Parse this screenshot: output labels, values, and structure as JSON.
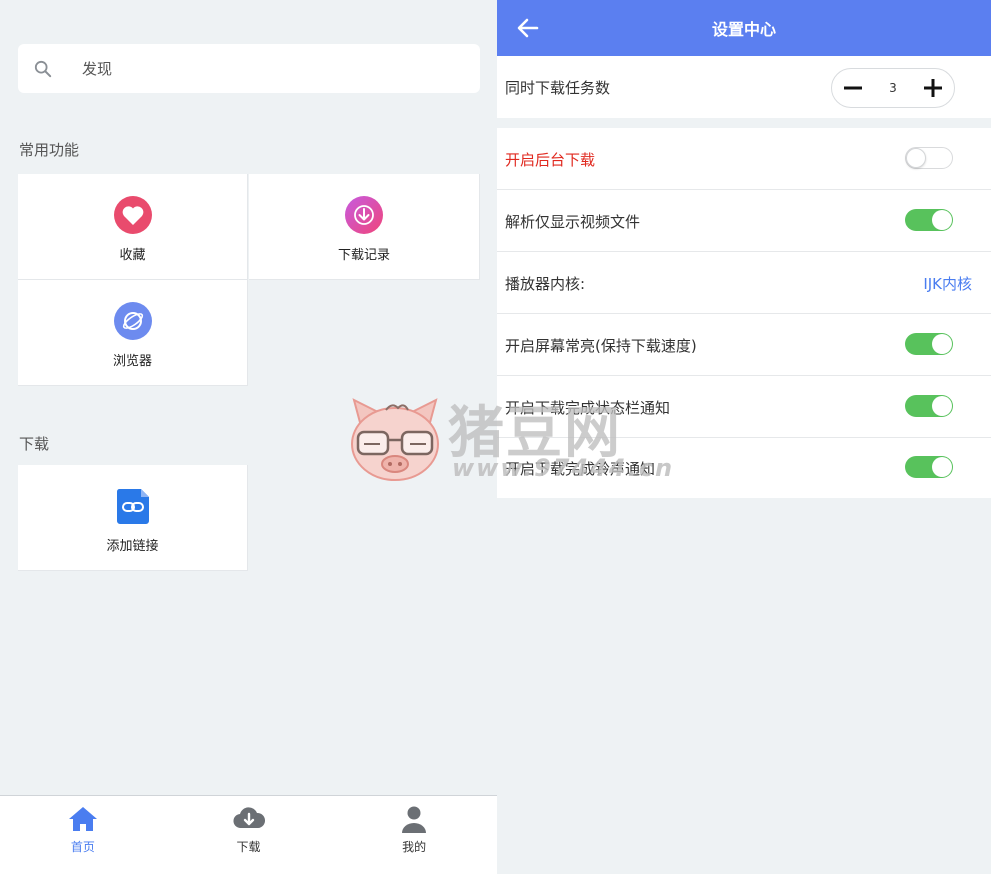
{
  "left": {
    "search": {
      "placeholder": "发现"
    },
    "sections": {
      "common": "常用功能",
      "download": "下载"
    },
    "common_items": [
      {
        "label": "收藏",
        "icon": "heart-icon",
        "color": "#e94b6d"
      },
      {
        "label": "下载记录",
        "icon": "download-arrow-icon",
        "color": "#e24a8a"
      },
      {
        "label": "浏览器",
        "icon": "planet-icon",
        "color": "#6d8bef"
      }
    ],
    "download_items": [
      {
        "label": "添加链接",
        "icon": "link-icon",
        "color": "#2a79e8"
      }
    ],
    "tabs": [
      {
        "label": "首页",
        "icon": "home-icon",
        "active": true
      },
      {
        "label": "下载",
        "icon": "cloud-download-icon",
        "active": false
      },
      {
        "label": "我的",
        "icon": "user-icon",
        "active": false
      }
    ]
  },
  "right": {
    "header": {
      "title": "设置中心"
    },
    "concurrent": {
      "label": "同时下载任务数",
      "value": "3"
    },
    "settings": [
      {
        "label": "开启后台下载",
        "on": false,
        "highlight": true
      },
      {
        "label": "解析仅显示视频文件",
        "on": true
      },
      {
        "label": "播放器内核:",
        "value": "IJK内核"
      },
      {
        "label": "开启屏幕常亮(保持下载速度)",
        "on": true
      },
      {
        "label": "开启下载完成状态栏通知",
        "on": true
      },
      {
        "label": "开启下载完成铃声通知",
        "on": true
      }
    ]
  },
  "watermark": {
    "brand": "猪豆网",
    "url": "www.97444.cn"
  },
  "colors": {
    "accent": "#5b7ff0",
    "toggle_on": "#58c25c",
    "link": "#4a7df0",
    "warning": "#e0291f"
  }
}
